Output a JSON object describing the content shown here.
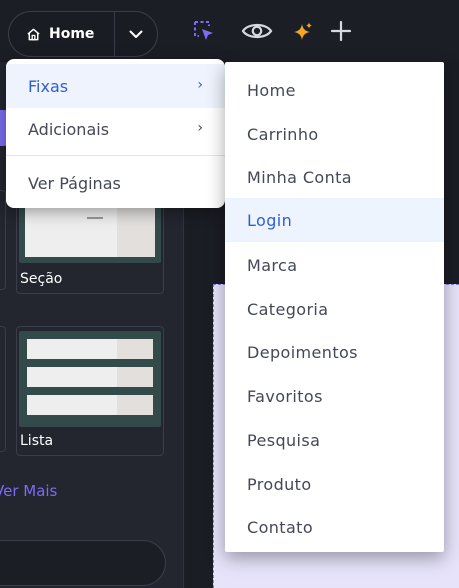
{
  "topbar": {
    "page_label": "Home",
    "icons": [
      "home-icon",
      "chevron-down-icon",
      "select-cursor-icon",
      "eye-icon",
      "sparkle-icon",
      "plus-icon"
    ]
  },
  "left_panel": {
    "cards": [
      {
        "caption": "Seção"
      },
      {
        "caption": "Lista"
      }
    ],
    "see_more": "Ver Mais"
  },
  "menu": {
    "items": [
      {
        "label": "Fixas",
        "has_submenu": true,
        "active": true
      },
      {
        "label": "Adicionais",
        "has_submenu": true,
        "active": false
      },
      {
        "label": "Ver Páginas",
        "has_submenu": false,
        "active": false
      }
    ],
    "arrow": "›"
  },
  "submenu": {
    "items": [
      "Home",
      "Carrinho",
      "Minha Conta",
      "Login",
      "Marca",
      "Categoria",
      "Depoimentos",
      "Favoritos",
      "Pesquisa",
      "Produto",
      "Contato"
    ],
    "active_item": "Login"
  },
  "colors": {
    "accent": "#7c6cf3",
    "active_text": "#2f5fcf",
    "active_bg": "#eef3fd",
    "sparkle": "#f5a524",
    "background": "#1c1e26"
  }
}
